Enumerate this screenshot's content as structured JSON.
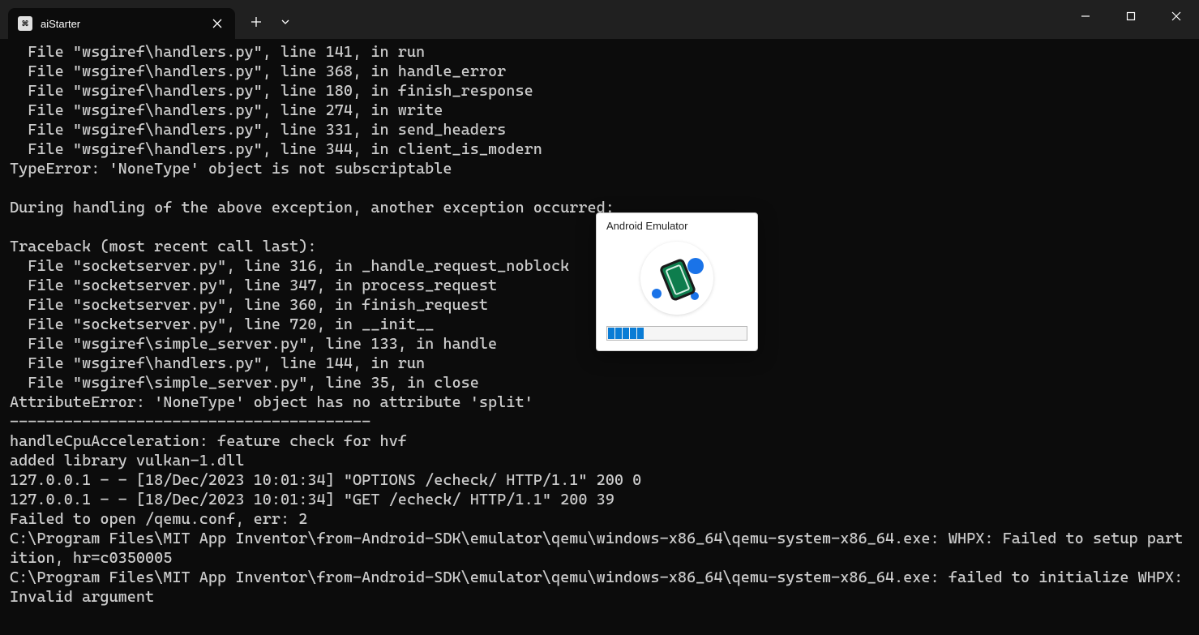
{
  "window": {
    "tab_title": "aiStarter"
  },
  "terminal": {
    "lines": [
      "  File \"wsgiref\\handlers.py\", line 141, in run",
      "  File \"wsgiref\\handlers.py\", line 368, in handle_error",
      "  File \"wsgiref\\handlers.py\", line 180, in finish_response",
      "  File \"wsgiref\\handlers.py\", line 274, in write",
      "  File \"wsgiref\\handlers.py\", line 331, in send_headers",
      "  File \"wsgiref\\handlers.py\", line 344, in client_is_modern",
      "TypeError: 'NoneType' object is not subscriptable",
      "",
      "During handling of the above exception, another exception occurred:",
      "",
      "Traceback (most recent call last):",
      "  File \"socketserver.py\", line 316, in _handle_request_noblock",
      "  File \"socketserver.py\", line 347, in process_request",
      "  File \"socketserver.py\", line 360, in finish_request",
      "  File \"socketserver.py\", line 720, in __init__",
      "  File \"wsgiref\\simple_server.py\", line 133, in handle",
      "  File \"wsgiref\\handlers.py\", line 144, in run",
      "  File \"wsgiref\\simple_server.py\", line 35, in close",
      "AttributeError: 'NoneType' object has no attribute 'split'",
      "----------------------------------------",
      "handleCpuAcceleration: feature check for hvf",
      "added library vulkan-1.dll",
      "127.0.0.1 - - [18/Dec/2023 10:01:34] \"OPTIONS /echeck/ HTTP/1.1\" 200 0",
      "127.0.0.1 - - [18/Dec/2023 10:01:34] \"GET /echeck/ HTTP/1.1\" 200 39",
      "Failed to open /qemu.conf, err: 2",
      "C:\\Program Files\\MIT App Inventor\\from-Android-SDK\\emulator\\qemu\\windows-x86_64\\qemu-system-x86_64.exe: WHPX: Failed to setup partition, hr=c0350005",
      "C:\\Program Files\\MIT App Inventor\\from-Android-SDK\\emulator\\qemu\\windows-x86_64\\qemu-system-x86_64.exe: failed to initialize WHPX: Invalid argument"
    ]
  },
  "dialog": {
    "title": "Android Emulator",
    "progress_blocks": 5
  }
}
